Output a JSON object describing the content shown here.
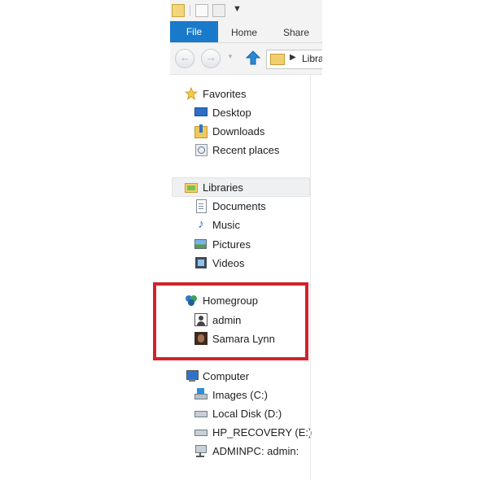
{
  "ribbon": {
    "tabs": [
      {
        "label": "File"
      },
      {
        "label": "Home"
      },
      {
        "label": "Share"
      }
    ]
  },
  "address": {
    "path": "Libra"
  },
  "nav": {
    "favorites": {
      "label": "Favorites",
      "items": [
        {
          "label": "Desktop",
          "icon": "desktop-icon"
        },
        {
          "label": "Downloads",
          "icon": "downloads-icon"
        },
        {
          "label": "Recent places",
          "icon": "recent-places-icon"
        }
      ]
    },
    "libraries": {
      "label": "Libraries",
      "items": [
        {
          "label": "Documents",
          "icon": "documents-icon"
        },
        {
          "label": "Music",
          "icon": "music-icon"
        },
        {
          "label": "Pictures",
          "icon": "pictures-icon"
        },
        {
          "label": "Videos",
          "icon": "videos-icon"
        }
      ]
    },
    "homegroup": {
      "label": "Homegroup",
      "items": [
        {
          "label": "admin",
          "icon": "user-icon"
        },
        {
          "label": "Samara Lynn",
          "icon": "user-photo-icon"
        }
      ]
    },
    "computer": {
      "label": "Computer",
      "items": [
        {
          "label": "Images (C:)",
          "icon": "system-drive-icon"
        },
        {
          "label": "Local Disk (D:)",
          "icon": "drive-icon"
        },
        {
          "label": "HP_RECOVERY (E:)",
          "icon": "drive-icon"
        },
        {
          "label": "ADMINPC: admin:",
          "icon": "network-drive-icon"
        }
      ]
    }
  },
  "colors": {
    "file_tab": "#1979ca",
    "highlight_box": "#d2232a"
  }
}
